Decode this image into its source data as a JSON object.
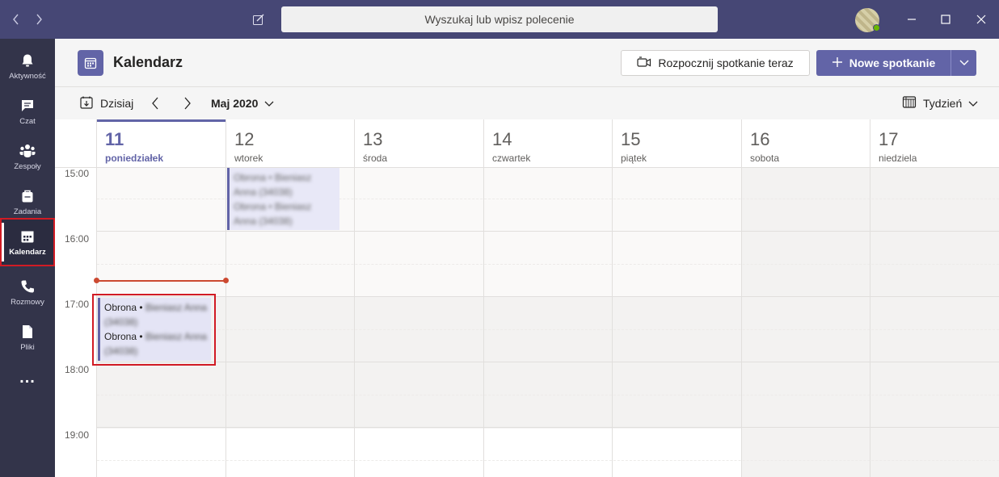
{
  "titlebar": {
    "search_placeholder": "Wyszukaj lub wpisz polecenie"
  },
  "rail": {
    "items": [
      {
        "label": "Aktywność",
        "icon": "bell-icon"
      },
      {
        "label": "Czat",
        "icon": "chat-icon"
      },
      {
        "label": "Zespoły",
        "icon": "teams-icon"
      },
      {
        "label": "Zadania",
        "icon": "assignments-icon"
      },
      {
        "label": "Kalendarz",
        "icon": "calendar-icon",
        "active": true
      },
      {
        "label": "Rozmowy",
        "icon": "phone-icon"
      },
      {
        "label": "Pliki",
        "icon": "file-icon"
      }
    ],
    "more": "..."
  },
  "header": {
    "title": "Kalendarz",
    "meet_now": "Rozpocznij spotkanie teraz",
    "new_meeting": "Nowe spotkanie"
  },
  "toolbar": {
    "today": "Dzisiaj",
    "month": "Maj 2020",
    "view": "Tydzień"
  },
  "days": [
    {
      "num": "11",
      "name": "poniedziałek",
      "today": true
    },
    {
      "num": "12",
      "name": "wtorek"
    },
    {
      "num": "13",
      "name": "środa"
    },
    {
      "num": "14",
      "name": "czwartek"
    },
    {
      "num": "15",
      "name": "piątek"
    },
    {
      "num": "16",
      "name": "sobota"
    },
    {
      "num": "17",
      "name": "niedziela"
    }
  ],
  "times": [
    "15:00",
    "16:00",
    "17:00",
    "18:00",
    "19:00"
  ],
  "events": {
    "monday": [
      {
        "prefix": "Obrona • ",
        "name": "Bieniasz Anna",
        "code": "(34038)"
      },
      {
        "prefix": "Obrona • ",
        "name": "Bieniasz Anna",
        "code": "(34038)"
      }
    ],
    "tuesday": [
      {
        "text": "Obrona • Bieniasz Anna (34038)"
      },
      {
        "text": "Obrona • Bieniasz Anna (34038)"
      }
    ]
  },
  "colors": {
    "titlebar": "#464775",
    "rail": "#33344a",
    "accent": "#6264a7",
    "highlight": "#d11b24",
    "now_line": "#cc4a31"
  }
}
